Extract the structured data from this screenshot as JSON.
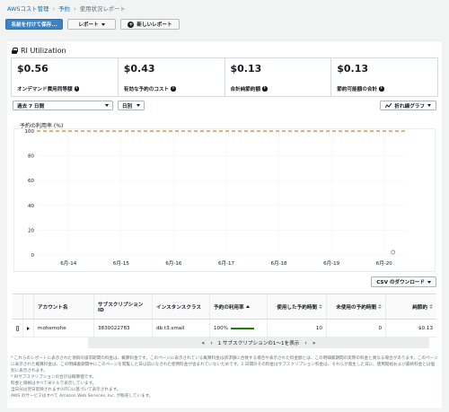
{
  "breadcrumb": {
    "root": "AWSコスト管理",
    "section": "予約",
    "current": "使用状況レポート"
  },
  "toolbar": {
    "save_label": "名前を付けて保存...",
    "report_label": "レポート",
    "new_report_label": "新しいレポート"
  },
  "section": {
    "title": "RI Utilization"
  },
  "metrics": [
    {
      "value": "$0.56",
      "label": "オンデマンド費用同等額"
    },
    {
      "value": "$0.43",
      "label": "有効な予約のコスト"
    },
    {
      "value": "$0.13",
      "label": "合計純節約額"
    },
    {
      "value": "$0.13",
      "label": "節約可能額の合計"
    }
  ],
  "filters": {
    "range": "過去 7 日間",
    "granularity": "日別",
    "graph_type": "折れ線グラフ"
  },
  "chart_data": {
    "type": "line",
    "title": "",
    "ylabel": "予約の利用率 (%)",
    "x": [
      "6月-14",
      "6月-15",
      "6月-16",
      "6月-17",
      "6月-18",
      "6月-19",
      "6月-20"
    ],
    "y_ticks": [
      "100",
      "80",
      "60",
      "40",
      "20",
      "0"
    ],
    "ylim": [
      0,
      100
    ],
    "threshold": {
      "value": 100,
      "color": "#d45b07",
      "style": "dashed"
    },
    "series": [
      {
        "values": [
          null,
          null,
          null,
          null,
          null,
          null,
          0
        ],
        "marker": "hollow-circle"
      }
    ],
    "grid": true
  },
  "csv": {
    "label": "CSV のダウンロード"
  },
  "table": {
    "headers": [
      "アカウント名",
      "サブスクリプション ID",
      "インスタンスクラス",
      "予約の利用率",
      "使用した予約時間",
      "未使用の予約時間",
      "純節約"
    ],
    "rows": [
      {
        "account": "mohemohe",
        "subscription": "3830022783",
        "instance": "db.t3.small",
        "utilization": "100%",
        "used": "10",
        "unused": "0",
        "savings": "$0.13"
      }
    ]
  },
  "pager": {
    "text": "1 サブスクリプションの1〜1を表示",
    "prev": "‹",
    "next": "›",
    "first": "«",
    "last": "»"
  },
  "notes": [
    "* これらのレポートに表示された項目の請求期間の料金は、概算料金です。このページに表示されている概算料金は請求額に合致する場合や表示された料金額とは、この明細書期間の実際の料金と異なる場合があります。このページに表示された概算料金は、この明細書期間中にこのページを閲覧した日以前になされた使用料金が含まれていないためです。1 日間のその料金はサブスクリプション料金は、それらが発生した日に、使用開始および最終料金とは個別に表示されます。",
    "* RIサブスクリプションの合計は概算値です。",
    "料金と価格はすべて米ドルで表示しています。",
    "当日分は翌日反映されます(UTC)に基づいて表示されます。",
    "AWS のサービスはすべて Amazon Web Services, Inc. が販売しています。"
  ]
}
